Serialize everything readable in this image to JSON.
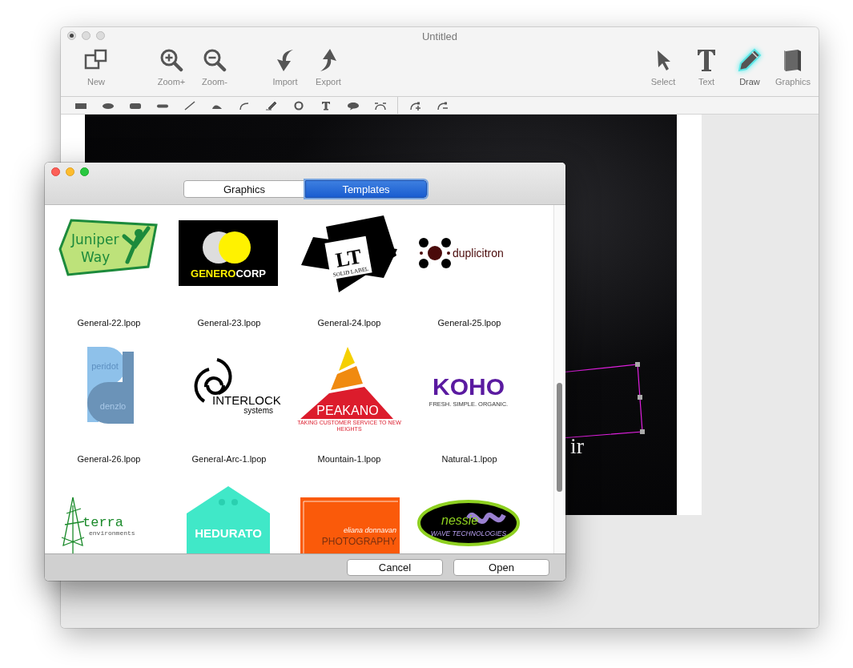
{
  "window": {
    "title": "Untitled"
  },
  "toolbar_left": [
    {
      "kind": "new",
      "label": "New",
      "selected": false
    },
    {
      "kind": "zoom-in",
      "label": "Zoom+",
      "selected": false
    },
    {
      "kind": "zoom-out",
      "label": "Zoom-",
      "selected": false
    },
    {
      "kind": "import",
      "label": "Import",
      "selected": false
    },
    {
      "kind": "export",
      "label": "Export",
      "selected": false
    }
  ],
  "toolbar_right": [
    {
      "kind": "select",
      "label": "Select",
      "selected": false
    },
    {
      "kind": "text",
      "label": "Text",
      "selected": false
    },
    {
      "kind": "draw",
      "label": "Draw",
      "selected": true
    },
    {
      "kind": "graphics",
      "label": "Graphics",
      "selected": false
    }
  ],
  "shape_tools": [
    {
      "kind": "rect"
    },
    {
      "kind": "ellipse"
    },
    {
      "kind": "rounded-rect"
    },
    {
      "kind": "pill"
    },
    {
      "kind": "line"
    },
    {
      "kind": "wedge"
    },
    {
      "kind": "curve"
    },
    {
      "kind": "pen"
    },
    {
      "kind": "ring"
    },
    {
      "kind": "text"
    },
    {
      "kind": "bubble"
    },
    {
      "kind": "bezier"
    }
  ],
  "point_tools": [
    {
      "kind": "add-point"
    },
    {
      "kind": "remove-point"
    }
  ],
  "canvas": {
    "text_fragment": "ir"
  },
  "dialog": {
    "tabs": [
      {
        "label": "Graphics",
        "selected": false
      },
      {
        "label": "Templates",
        "selected": true
      }
    ],
    "templates": [
      {
        "kind": "juniper",
        "texts": [
          "Juniper",
          "Way"
        ],
        "name": "General-22.lpop"
      },
      {
        "kind": "generocorp",
        "texts": [
          "GENERO",
          "CORP"
        ],
        "name": "General-23.lpop"
      },
      {
        "kind": "lt",
        "texts": [
          "LT",
          "SOLID LABEL"
        ],
        "name": "General-24.lpop"
      },
      {
        "kind": "duplicitron",
        "texts": [
          "duplicitron"
        ],
        "name": "General-25.lpop"
      },
      {
        "kind": "peridot",
        "texts": [
          "peridot",
          "denzlo"
        ],
        "name": "General-26.lpop"
      },
      {
        "kind": "interlock",
        "texts": [
          "INTERLOCK",
          "systems"
        ],
        "name": "General-Arc-1.lpop"
      },
      {
        "kind": "peakano",
        "texts": [
          "PEAKANO",
          "TAKING CUSTOMER SERVICE TO NEW HEIGHTS"
        ],
        "name": "Mountain-1.lpop"
      },
      {
        "kind": "koho",
        "texts": [
          "KOHO",
          "FRESH. SIMPLE. ORGANIC."
        ],
        "name": "Natural-1.lpop"
      },
      {
        "kind": "terra",
        "texts": [
          "terra",
          "environments"
        ]
      },
      {
        "kind": "hedurato",
        "texts": [
          "HEDURATO"
        ]
      },
      {
        "kind": "photography",
        "texts": [
          "eliana donnavan",
          "PHOTOGRAPHY"
        ]
      },
      {
        "kind": "nessie",
        "texts": [
          "nessie",
          "WAVE TECHNOLOGIES"
        ]
      }
    ],
    "buttons": [
      "Cancel",
      "Open"
    ]
  }
}
